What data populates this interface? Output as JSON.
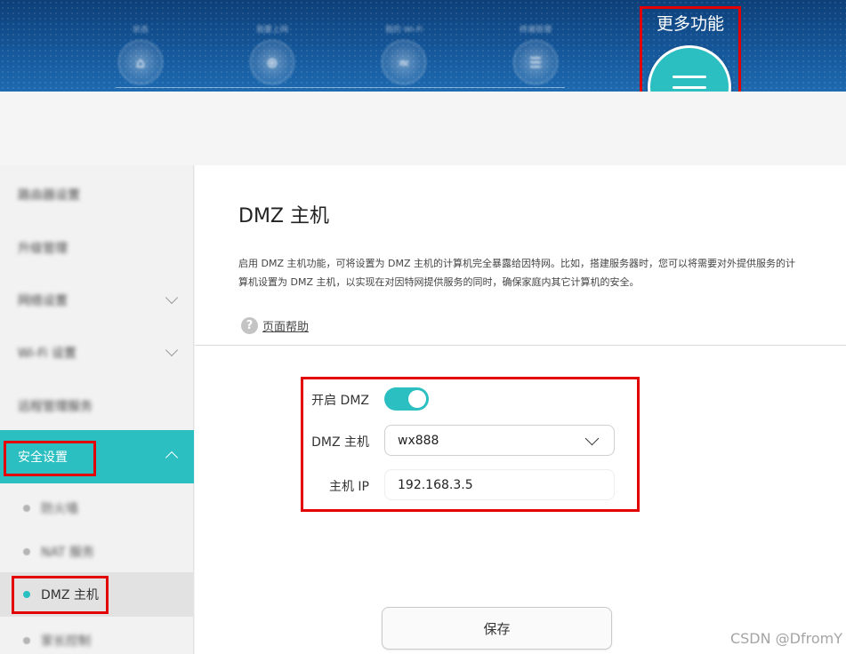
{
  "topnav": {
    "items": [
      {
        "label": "状态",
        "icon": "home-icon"
      },
      {
        "label": "我要上网",
        "icon": "globe-icon"
      },
      {
        "label": "我的 Wi-Fi",
        "icon": "wifi-icon"
      },
      {
        "label": "终端管理",
        "icon": "devices-icon"
      }
    ],
    "more_label": "更多功能",
    "more_icon": "menu-icon"
  },
  "sidebar": {
    "items": [
      {
        "label": "路由器设置"
      },
      {
        "label": "升级管理"
      },
      {
        "label": "网络设置"
      },
      {
        "label": "Wi-Fi 设置"
      },
      {
        "label": "远程管理服务"
      },
      {
        "label": "安全设置"
      }
    ],
    "sub_items": [
      {
        "label": "防火墙"
      },
      {
        "label": "NAT 服务"
      },
      {
        "label": "DMZ 主机"
      },
      {
        "label": "家长控制"
      }
    ]
  },
  "main": {
    "title": "DMZ 主机",
    "description_line1": "启用 DMZ 主机功能，可将设置为 DMZ 主机的计算机完全暴露给因特网。比如，搭建服务器时，您可以将需要对外提供服务的计",
    "description_line2": "算机设置为 DMZ 主机，以实现在对因特网提供服务的同时，确保家庭内其它计算机的安全。",
    "help_label": "页面帮助",
    "form": {
      "enable_label": "开启 DMZ",
      "enable_value": true,
      "host_label": "DMZ 主机",
      "host_value": "wx888",
      "ip_label": "主机 IP",
      "ip_value": "192.168.3.5"
    },
    "save_label": "保存"
  },
  "watermark": "CSDN @DfromY",
  "colors": {
    "accent": "#2bbfc1",
    "banner": "#15579a",
    "highlight": "#e30000"
  }
}
